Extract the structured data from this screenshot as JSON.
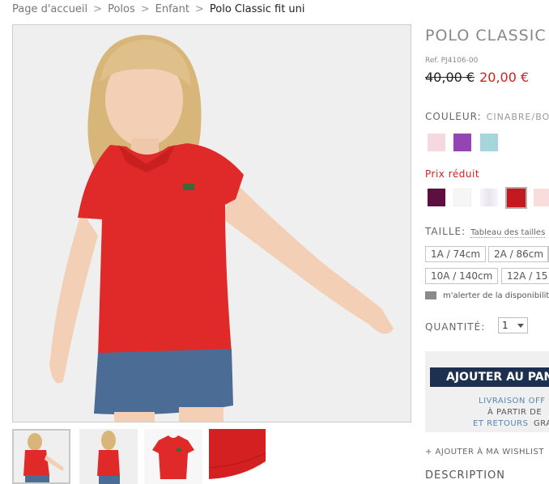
{
  "breadcrumb": {
    "items": [
      "Page d'accueil",
      "Polos",
      "Enfant"
    ],
    "current": "Polo Classic fit uni",
    "separator": ">"
  },
  "product": {
    "title": "POLO CLASSIC F",
    "ref": "Ref. PJ4106-00",
    "old_price": "40,00 €",
    "new_price": "20,00 €"
  },
  "color": {
    "label": "COULEUR:",
    "value": "CINABRE/BO",
    "swatches": [
      "#f6d9e0",
      "#9245b3",
      "#a5d6de"
    ]
  },
  "reduced": {
    "label": "Prix réduit",
    "swatches": [
      "#5e0e3f",
      "#f6f6f6",
      "#f0eef5",
      "#c41a1f",
      "#fadcdc"
    ],
    "selected_index": 3
  },
  "size": {
    "label": "TAILLE:",
    "guide": "Tableau des tailles",
    "options": [
      "1A / 74cm",
      "2A / 86cm",
      "",
      "10A / 140cm",
      "12A / 15"
    ]
  },
  "alert": {
    "text": "m'alerter de la disponibilité"
  },
  "quantity": {
    "label": "QUANTITÉ:",
    "value": "1"
  },
  "cart": {
    "button": "AJOUTER AU PAN",
    "line1": "LIVRAISON OFF",
    "line2": "À PARTIR DE",
    "line3a": "ET RETOURS",
    "line3b": "GRA"
  },
  "wishlist": {
    "label": "+ AJOUTER À MA WISHLIST"
  },
  "description": {
    "label": "DESCRIPTION"
  },
  "colors": {
    "price_red": "#d81e1e",
    "button_navy": "#1e3050",
    "link_blue": "#5585b5"
  }
}
